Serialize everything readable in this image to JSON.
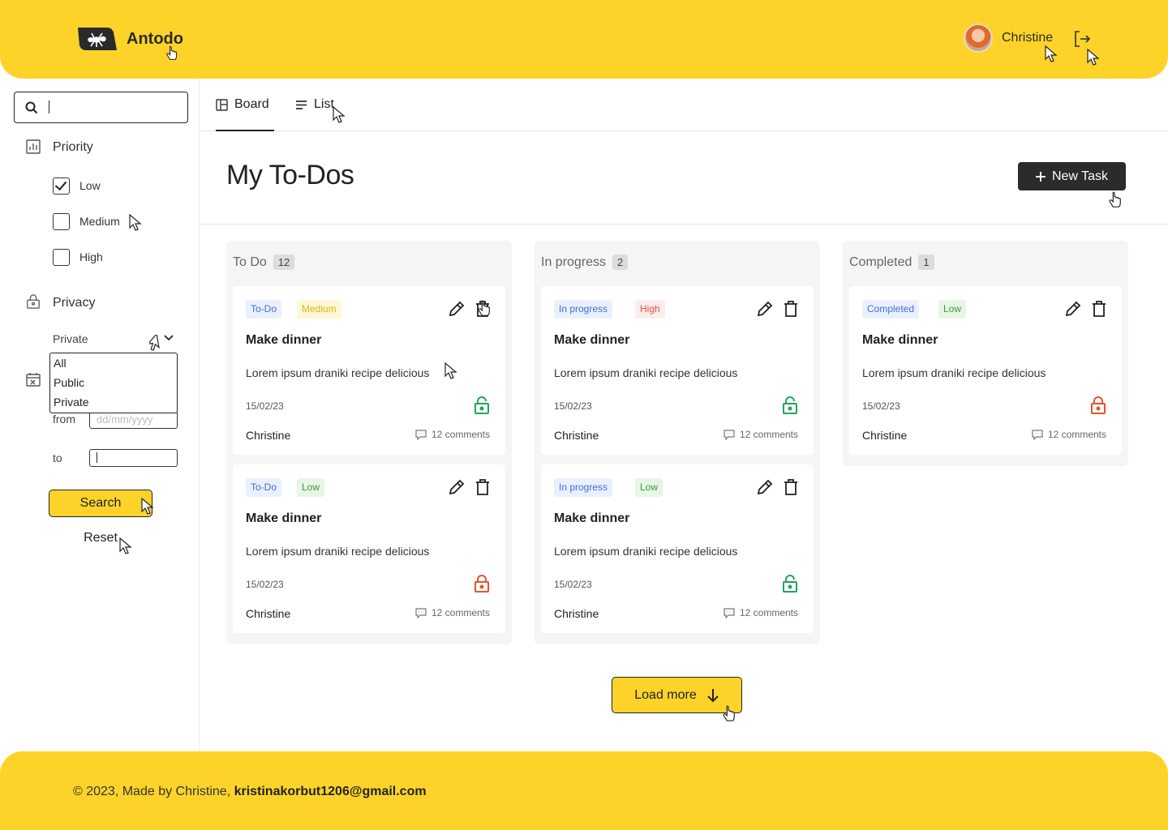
{
  "header": {
    "brand": "Antodo",
    "user_name": "Christine"
  },
  "sidebar": {
    "search": {
      "value": "",
      "placeholder": ""
    },
    "priority": {
      "title": "Priority",
      "options": [
        {
          "label": "Low",
          "checked": true
        },
        {
          "label": "Medium",
          "checked": false
        },
        {
          "label": "High",
          "checked": false
        }
      ]
    },
    "privacy": {
      "title": "Privacy",
      "selected": "Private",
      "options": [
        "All",
        "Public",
        "Private"
      ]
    },
    "date": {
      "from_label": "from",
      "from_placeholder": "dd/mm/yyyy",
      "to_label": "to",
      "to_value": ""
    },
    "search_button": "Search",
    "reset_button": "Reset"
  },
  "tabs": [
    {
      "label": "Board",
      "active": true
    },
    {
      "label": "List",
      "active": false
    }
  ],
  "main": {
    "title": "My To-Dos",
    "new_task_button": "New Task",
    "load_more_button": "Load more"
  },
  "columns": [
    {
      "title": "To Do",
      "count": "12",
      "cards": [
        {
          "status": "To-Do",
          "priority": "Medium",
          "priority_level": "medium",
          "title": "Make dinner",
          "description": "Lorem ipsum draniki recipe delicious",
          "date": "15/02/23",
          "author": "Christine",
          "comments": "12 comments",
          "locked": false
        },
        {
          "status": "To-Do",
          "priority": "Low",
          "priority_level": "low",
          "title": "Make dinner",
          "description": "Lorem ipsum draniki recipe delicious",
          "date": "15/02/23",
          "author": "Christine",
          "comments": "12 comments",
          "locked": true
        }
      ]
    },
    {
      "title": "In progress",
      "count": "2",
      "cards": [
        {
          "status": "In progress",
          "priority": "High",
          "priority_level": "high",
          "title": "Make dinner",
          "description": "Lorem ipsum draniki recipe delicious",
          "date": "15/02/23",
          "author": "Christine",
          "comments": "12 comments",
          "locked": false
        },
        {
          "status": "In progress",
          "priority": "Low",
          "priority_level": "low",
          "title": "Make dinner",
          "description": "Lorem ipsum draniki recipe delicious",
          "date": "15/02/23",
          "author": "Christine",
          "comments": "12 comments",
          "locked": false
        }
      ]
    },
    {
      "title": "Completed",
      "count": "1",
      "cards": [
        {
          "status": "Completed",
          "priority": "Low",
          "priority_level": "low",
          "title": "Make dinner",
          "description": "Lorem ipsum draniki recipe delicious",
          "date": "15/02/23",
          "author": "Christine",
          "comments": "12 comments",
          "locked": true
        }
      ]
    }
  ],
  "footer": {
    "text": "© 2023, Made by Christine,",
    "email": "kristinakorbut1206@gmail.com"
  },
  "colors": {
    "brand_yellow": "#FDD32A",
    "dark": "#2B2B2B",
    "unlocked_green": "#22A45D",
    "locked_red": "#E5532E"
  }
}
